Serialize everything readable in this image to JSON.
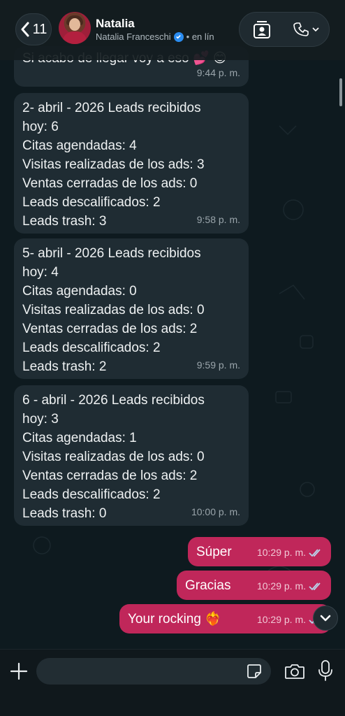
{
  "header": {
    "back_count": "11",
    "contact_name": "Natalia",
    "contact_full_name": "Natalia Franceschi",
    "status": "• en lín"
  },
  "messages": [
    {
      "direction": "incoming",
      "text": "Si acabo de llegar voy a eso 💕 😊",
      "time": "9:44 p. m."
    },
    {
      "direction": "incoming",
      "text": "2-  abril - 2026 Leads recibidos\nhoy: 6\nCitas agendadas: 4\nVisitas realizadas de los ads: 3\nVentas cerradas de los ads: 0\nLeads descalificados: 2\nLeads trash: 3",
      "time": "9:58 p. m."
    },
    {
      "direction": "incoming",
      "text": "5-  abril - 2026 Leads recibidos\nhoy: 4\nCitas agendadas: 0\nVisitas realizadas de los ads: 0\nVentas cerradas de los ads: 2\nLeads descalificados: 2\nLeads trash: 2",
      "time": "9:59 p. m."
    },
    {
      "direction": "incoming",
      "text": "6 -  abril - 2026 Leads recibidos\nhoy: 3\nCitas agendadas: 1\nVisitas realizadas de los ads: 0\nVentas cerradas de los ads: 2\nLeads descalificados: 2\nLeads trash: 0",
      "time": "10:00 p. m."
    },
    {
      "direction": "outgoing",
      "text": "Súper",
      "time": "10:29 p. m."
    },
    {
      "direction": "outgoing",
      "text": "Gracias",
      "time": "10:29 p. m."
    },
    {
      "direction": "outgoing",
      "text": "Your rocking ❤️‍🔥",
      "time": "10:29 p. m."
    }
  ],
  "composer": {
    "placeholder": ""
  },
  "icons": {
    "back": "chevron-left-icon",
    "verified": "verified-badge-icon",
    "contact_card": "contact-card-icon",
    "call": "phone-icon",
    "plus": "plus-icon",
    "sticker": "sticker-icon",
    "camera": "camera-icon",
    "mic": "microphone-icon",
    "read_receipt": "double-check-icon",
    "scroll_down": "chevron-down-icon"
  },
  "colors": {
    "outgoing_bubble": "#c0275a",
    "incoming_bubble": "#1f2c33",
    "read_tick": "#53bdeb"
  }
}
